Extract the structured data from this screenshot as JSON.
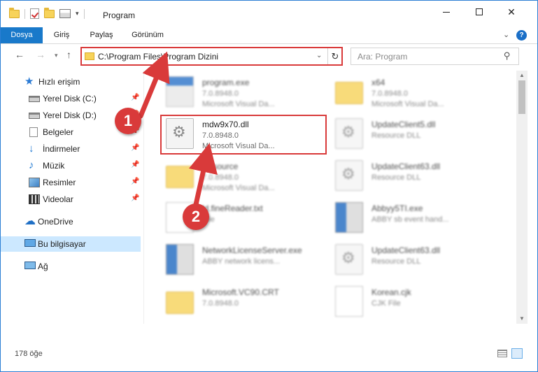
{
  "window": {
    "title": "Program"
  },
  "ribbon": {
    "tabs": [
      "Dosya",
      "Giriş",
      "Paylaş",
      "Görünüm"
    ]
  },
  "address": {
    "path": "C:\\Program Files\\Program Dizini"
  },
  "search": {
    "placeholder": "Ara: Program"
  },
  "sidebar": {
    "items": [
      {
        "label": "Hızlı erişim",
        "icon": "star-icon",
        "pinned": false
      },
      {
        "label": "Yerel Disk (C:)",
        "icon": "disk-icon",
        "pinned": true
      },
      {
        "label": "Yerel Disk (D:)",
        "icon": "disk-icon",
        "pinned": true
      },
      {
        "label": "Belgeler",
        "icon": "document-icon",
        "pinned": true
      },
      {
        "label": "İndirmeler",
        "icon": "download-icon",
        "pinned": true
      },
      {
        "label": "Müzik",
        "icon": "music-icon",
        "pinned": true
      },
      {
        "label": "Resimler",
        "icon": "pictures-icon",
        "pinned": true
      },
      {
        "label": "Videolar",
        "icon": "video-icon",
        "pinned": true
      },
      {
        "label": "OneDrive",
        "icon": "cloud-icon",
        "pinned": false
      },
      {
        "label": "Bu bilgisayar",
        "icon": "computer-icon",
        "pinned": false,
        "selected": true
      },
      {
        "label": "Ağ",
        "icon": "network-icon",
        "pinned": false
      }
    ]
  },
  "files": [
    {
      "name": "program.exe",
      "line1": "7.0.8948.0",
      "line2": "Microsoft Visual Da...",
      "icon": "exe-icon"
    },
    {
      "name": "x64",
      "line1": "7.0.8948.0",
      "line2": "Microsoft Visual Da...",
      "icon": "folder-icon"
    },
    {
      "name": "mdw9x70.dll",
      "line1": "7.0.8948.0",
      "line2": "Microsoft Visual Da...",
      "icon": "gear-file-icon"
    },
    {
      "name": "UpdateClient5.dll",
      "line1": "Resource DLL",
      "line2": "",
      "icon": "gear-file-icon"
    },
    {
      "name": "Resource",
      "line1": "7.0.8948.0",
      "line2": "Microsoft Visual Da...",
      "icon": "folder-icon"
    },
    {
      "name": "UpdateClient63.dll",
      "line1": "Resource DLL",
      "line2": "",
      "icon": "gear-file-icon"
    },
    {
      "name": "ld.fineReader.txt",
      "line1": "File",
      "line2": "",
      "icon": "text-file-icon"
    },
    {
      "name": "Abbyy5TI.exe",
      "line1": "ABBY sb event hand...",
      "line2": "",
      "icon": "exe-icon"
    },
    {
      "name": "NetworkLicenseServer.exe",
      "line1": "ABBY network licens...",
      "line2": "",
      "icon": "exe-icon"
    },
    {
      "name": "UpdateClient63.dll",
      "line1": "Resource DLL",
      "line2": "",
      "icon": "gear-file-icon"
    },
    {
      "name": "Microsoft.VC90.CRT",
      "line1": "7.0.8948.0",
      "line2": "",
      "icon": "folder-icon"
    },
    {
      "name": "Korean.cjk",
      "line1": "CJK File",
      "line2": "",
      "icon": "text-file-icon"
    }
  ],
  "callouts": [
    "1",
    "2"
  ],
  "status": {
    "count": "178 öğe"
  },
  "colors": {
    "accent": "#1979ca",
    "highlight": "#d93a3a",
    "selection": "#cce8ff"
  }
}
